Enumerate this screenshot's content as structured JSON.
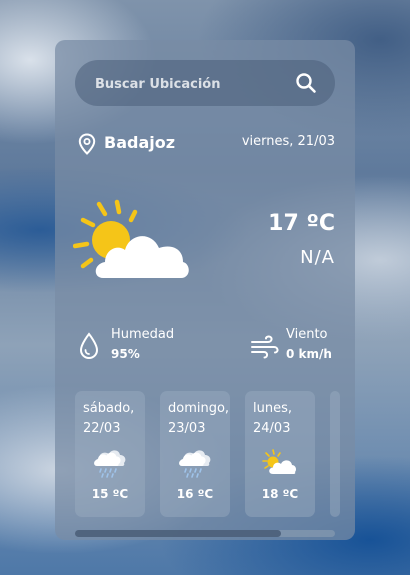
{
  "search": {
    "placeholder": "Buscar Ubicación",
    "icon": "search-icon"
  },
  "location": {
    "city": "Badajoz",
    "date": "viernes, 21/03",
    "icon": "map-pin-icon"
  },
  "current": {
    "temperature": "17 ºC",
    "description": "N/A",
    "icon": "partly-cloudy-icon"
  },
  "details": {
    "humidity": {
      "label": "Humedad",
      "value": "95%",
      "icon": "water-drop-icon"
    },
    "wind": {
      "label": "Viento",
      "value": "0 km/h",
      "icon": "wind-icon"
    }
  },
  "forecast": [
    {
      "day": "sábado,",
      "date": "22/03",
      "temp": "15 ºC",
      "icon": "rain-cloud-icon"
    },
    {
      "day": "domingo,",
      "date": "23/03",
      "temp": "16 ºC",
      "icon": "rain-cloud-icon"
    },
    {
      "day": "lunes,",
      "date": "24/03",
      "temp": "18 ºC",
      "icon": "partly-cloudy-icon"
    }
  ],
  "colors": {
    "sun": "#f5c518",
    "cloud": "#ffffff",
    "rain": "#9fc3ea"
  }
}
